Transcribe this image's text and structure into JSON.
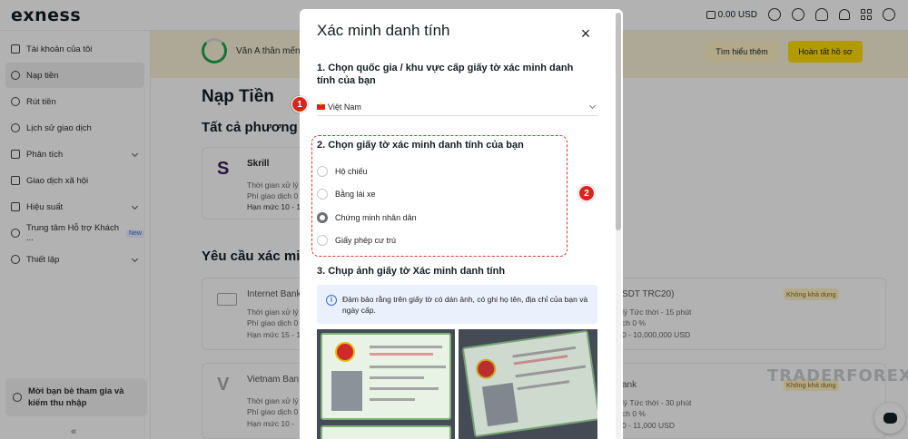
{
  "topbar": {
    "logo": "exness",
    "balance": "0.00 USD"
  },
  "sidebar": {
    "items": [
      {
        "label": "Tài khoản của tôi"
      },
      {
        "label": "Nạp tiền"
      },
      {
        "label": "Rút tiền"
      },
      {
        "label": "Lịch sử giao dịch"
      },
      {
        "label": "Phân tích"
      },
      {
        "label": "Giao dịch xã hội"
      },
      {
        "label": "Hiệu suất"
      },
      {
        "label": "Trung tâm Hỗ trợ Khách ..."
      },
      {
        "label": "Thiết lập"
      }
    ],
    "new_badge": "New",
    "invite": "Mời bạn bè tham gia và kiếm thu nhập",
    "collapse": "«"
  },
  "main": {
    "banner_text": "Văn A thân mến,",
    "learn_more": "Tìm hiểu thêm",
    "complete_profile": "Hoàn tất hồ sơ",
    "page_title": "Nạp Tiền",
    "all_methods": "Tất cả phương th",
    "verify_required": "Yêu cầu xác minh",
    "skrill": {
      "name": "Skrill",
      "l1": "Thời gian xử lý",
      "l2": "Phí giao dịch 0",
      "l3": "Hạn mức 10 - 1"
    },
    "internet_bank": {
      "name": "Internet Bank",
      "l1": "Thời gian xử lý",
      "l2": "Phí giao dịch 0",
      "l3": "Hạn mức 15 - 1"
    },
    "vietnam_bank": {
      "name": "Vietnam Ban",
      "l1": "Thời gian xử lý",
      "l2": "Phí giao dịch 0",
      "l3": "Hạn mức 10 -"
    },
    "usdt": {
      "name": "SDT TRC20)",
      "badge": "Không khả dụng",
      "l1": "lý Tức thời - 15 phút",
      "l2": "ch 0 %",
      "l3": "0 - 10,000,000 USD"
    },
    "bank2": {
      "name": "ank",
      "badge": "Không khả dụng",
      "l1": "lý Tức thời - 30 phút",
      "l2": "ch 0 %",
      "l3": "0 - 11,000 USD"
    }
  },
  "modal": {
    "title": "Xác minh danh tính",
    "close": "×",
    "step1": "1. Chọn quốc gia / khu vực cấp giấy tờ xác minh danh tính của bạn",
    "country": "Việt Nam",
    "step2": "2. Chọn giấy tờ xác minh danh tính của bạn",
    "options": [
      {
        "label": "Hộ chiếu",
        "checked": false
      },
      {
        "label": "Bằng lái xe",
        "checked": false
      },
      {
        "label": "Chứng minh nhân dân",
        "checked": true
      },
      {
        "label": "Giấy phép cư trú",
        "checked": false
      }
    ],
    "step3": "3. Chụp ảnh giấy tờ Xác minh danh tính",
    "info": "Đảm bảo rằng trên giấy tờ có dán ảnh, có ghi họ tên, địa chỉ của bạn và ngày cấp."
  },
  "markers": [
    "1",
    "2"
  ],
  "watermark": "TRADERFOREX",
  "colors": {
    "accent_yellow": "#ffde02",
    "marker_red": "#d8241d",
    "dashed_red": "#e0322b"
  }
}
